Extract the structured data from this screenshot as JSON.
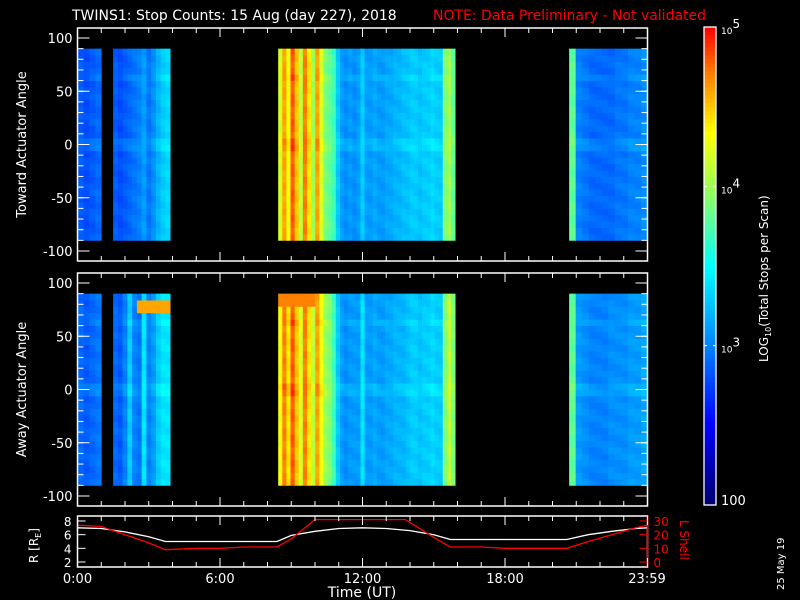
{
  "chart_data": {
    "type": "heatmap",
    "title": "TWINS1: Stop Counts: 15 Aug (day 227), 2018",
    "note": "NOTE: Data Preliminary - Not validated",
    "xlabel": "Time (UT)",
    "xlim_hours": [
      0,
      24
    ],
    "xticks": [
      {
        "h": 0,
        "label": "0:00"
      },
      {
        "h": 6,
        "label": "6:00"
      },
      {
        "h": 12,
        "label": "12:00"
      },
      {
        "h": 18,
        "label": "18:00"
      },
      {
        "h": 23.98,
        "label": "23:59"
      }
    ],
    "colorbar": {
      "label_prefix": "LOG",
      "label_sub": "10",
      "label_suffix": "(Total Stops per Scan)",
      "range_log10": [
        2,
        5
      ],
      "ticks": [
        {
          "v": 2,
          "label": "100"
        },
        {
          "v": 3,
          "label": "10",
          "sup": "3"
        },
        {
          "v": 4,
          "label": "10",
          "sup": "4"
        },
        {
          "v": 5,
          "label": "10",
          "sup": "5"
        }
      ]
    },
    "panels": [
      {
        "name": "toward",
        "ylabel": "Toward Actuator Angle",
        "ylim": [
          -110,
          110
        ],
        "yticks": [
          {
            "v": 100,
            "label": "100"
          },
          {
            "v": 50,
            "label": "50"
          },
          {
            "v": 0,
            "label": "0"
          },
          {
            "v": -50,
            "label": "-50"
          },
          {
            "v": -100,
            "label": "-100"
          }
        ],
        "angle_range": [
          -90,
          90
        ],
        "segments": [
          {
            "start": 0.0,
            "end": 1.0,
            "cols": [
              2.85,
              2.8,
              2.85,
              2.9
            ]
          },
          {
            "start": 1.5,
            "end": 3.9,
            "cols": [
              2.85,
              2.8,
              2.85,
              2.9,
              2.95,
              3.0,
              3.1,
              2.95,
              3.05,
              3.2,
              3.3,
              3.35
            ]
          },
          {
            "start": 8.45,
            "end": 15.9,
            "cols": [
              4.2,
              4.6,
              4.3,
              4.8,
              4.5,
              4.1,
              4.7,
              4.4,
              4.0,
              4.6,
              4.2,
              3.9,
              3.8,
              3.7,
              3.3,
              3.1,
              3.05,
              3.1,
              3.05,
              3.1,
              3.3,
              3.1,
              3.1,
              3.15,
              3.1,
              3.1,
              3.15,
              3.15,
              3.2,
              3.2,
              3.25,
              3.25,
              3.3,
              3.3,
              3.25,
              3.3,
              3.3,
              3.35,
              3.3,
              3.3,
              3.9,
              4.0,
              3.8
            ]
          },
          {
            "start": 20.7,
            "end": 24.0,
            "cols": [
              3.8,
              3.0,
              2.95,
              2.9,
              2.9,
              2.9,
              2.9,
              2.95,
              2.95,
              3.0,
              3.0,
              3.05
            ]
          }
        ],
        "hotspots": []
      },
      {
        "name": "away",
        "ylabel": "Away Actuator Angle",
        "ylim": [
          -110,
          110
        ],
        "yticks": [
          {
            "v": 100,
            "label": "100"
          },
          {
            "v": 50,
            "label": "50"
          },
          {
            "v": 0,
            "label": "0"
          },
          {
            "v": -50,
            "label": "-50"
          },
          {
            "v": -100,
            "label": "-100"
          }
        ],
        "angle_range": [
          -90,
          90
        ],
        "segments": [
          {
            "start": 0.0,
            "end": 1.0,
            "cols": [
              2.9,
              2.85,
              2.9,
              2.95
            ]
          },
          {
            "start": 1.5,
            "end": 3.9,
            "cols": [
              2.9,
              2.85,
              3.0,
              3.3,
              3.0,
              2.95,
              3.4,
              3.0,
              3.1,
              3.3,
              3.4,
              3.4
            ]
          },
          {
            "start": 8.45,
            "end": 15.9,
            "cols": [
              4.3,
              4.7,
              4.4,
              4.8,
              4.5,
              4.2,
              4.7,
              4.4,
              4.1,
              4.6,
              4.3,
              4.0,
              3.9,
              3.7,
              3.3,
              3.1,
              3.05,
              3.1,
              3.1,
              3.1,
              3.4,
              3.1,
              3.1,
              3.15,
              3.1,
              3.1,
              3.15,
              3.15,
              3.2,
              3.2,
              3.2,
              3.25,
              3.3,
              3.3,
              3.25,
              3.3,
              3.3,
              3.35,
              3.3,
              3.3,
              3.9,
              4.1,
              3.9
            ]
          },
          {
            "start": 20.7,
            "end": 24.0,
            "cols": [
              3.8,
              3.1,
              3.05,
              3.0,
              3.0,
              3.0,
              3.05,
              3.05,
              3.05,
              3.1,
              3.1,
              3.15
            ]
          }
        ],
        "hotspots": [
          {
            "start": 2.4,
            "end": 3.9,
            "amin": 70,
            "amax": 85,
            "v": 4.6
          },
          {
            "start": 8.45,
            "end": 10.0,
            "amin": 78,
            "amax": 90,
            "v": 4.7
          }
        ]
      }
    ],
    "orbit": {
      "ylabel_left": "R [R",
      "ylabel_left_sub": "E",
      "ylabel_left_end": "]",
      "ylabel_right": "L Shell",
      "ylim_left": [
        2,
        8
      ],
      "ylim_right": [
        0,
        30
      ],
      "yticks_left": [
        "2",
        "4",
        "6",
        "8"
      ],
      "yticks_right": [
        "0",
        "10",
        "20",
        "30"
      ],
      "series": [
        {
          "name": "R",
          "color": "#ffffff",
          "axis": "left",
          "x": [
            0,
            1,
            2,
            3,
            3.7,
            5,
            6,
            7,
            8.4,
            9,
            10,
            11,
            12,
            13,
            14,
            15,
            15.7,
            17,
            18,
            19,
            20.6,
            21.5,
            22.5,
            23.5,
            24
          ],
          "y": [
            7.0,
            6.9,
            6.4,
            5.7,
            5.0,
            5.0,
            5.0,
            5.0,
            5.0,
            5.9,
            6.5,
            6.9,
            7.0,
            6.9,
            6.6,
            6.0,
            5.3,
            5.3,
            5.3,
            5.3,
            5.3,
            6.0,
            6.5,
            6.9,
            7.0
          ]
        },
        {
          "name": "L Shell",
          "color": "#ff0000",
          "axis": "right",
          "x": [
            0,
            1,
            2,
            3,
            3.7,
            5,
            6,
            7,
            8.4,
            9,
            10.0,
            13.8,
            15,
            15.7,
            17,
            18,
            19,
            20.6,
            21.5,
            22.5,
            23.5,
            24
          ],
          "y": [
            27,
            26,
            20,
            14,
            9,
            10,
            10,
            11,
            11,
            17,
            31,
            31,
            18,
            11,
            11,
            10,
            10,
            10,
            15,
            20,
            25,
            27
          ]
        }
      ]
    },
    "stamp": "25 May 19",
    "colors": {
      "note": "#ff0000",
      "axis": "#ffffff",
      "lshell": "#ff0000"
    }
  }
}
